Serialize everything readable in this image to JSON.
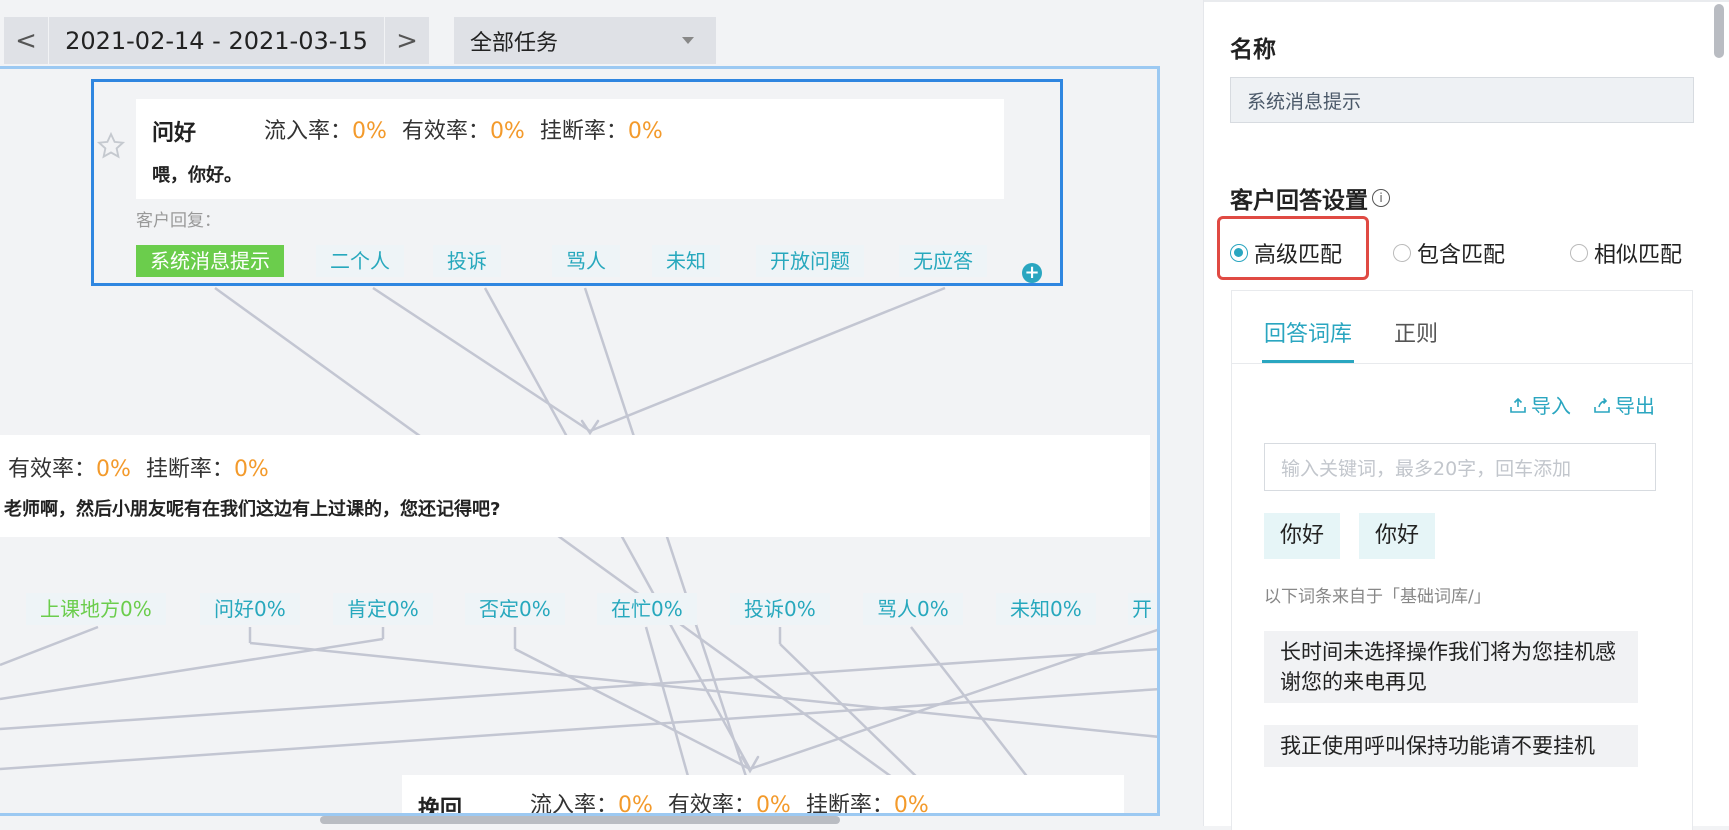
{
  "toolbar": {
    "prev_icon": "chevron-left-icon",
    "prev_glyph": "<",
    "date_range": "2021-02-14 - 2021-03-15",
    "next_icon": "chevron-right-icon",
    "next_glyph": ">",
    "task_filter": "全部任务"
  },
  "canvas": {
    "node1": {
      "title": "问好",
      "inflow_label": "流入率：",
      "inflow_value": "0%",
      "valid_label": "有效率：",
      "valid_value": "0%",
      "hangup_label": "挂断率：",
      "hangup_value": "0%",
      "message": "喂，你好。",
      "reply_label": "客户回复：",
      "replies": [
        "系统消息提示",
        "二个人",
        "投诉",
        "骂人",
        "未知",
        "开放问题",
        "无应答"
      ]
    },
    "node2": {
      "valid_label": "有效率：",
      "valid_value": "0%",
      "hangup_label": "挂断率：",
      "hangup_value": "0%",
      "message": "老师啊，然后小朋友呢有在我们这边有上过课的，您还记得吧?",
      "replies": [
        "上课地方0%",
        "问好0%",
        "肯定0%",
        "否定0%",
        "在忙0%",
        "投诉0%",
        "骂人0%",
        "未知0%",
        "开"
      ]
    },
    "node3": {
      "title": "挽回",
      "inflow_label": "流入率：",
      "inflow_value": "0%",
      "valid_label": "有效率：",
      "valid_value": "0%",
      "hangup_label": "挂断率：",
      "hangup_value": "0%"
    }
  },
  "panel": {
    "name_label": "名称",
    "name_value": "系统消息提示",
    "answer_settings_label": "客户回答设置",
    "match_modes": [
      {
        "label": "高级匹配",
        "selected": true
      },
      {
        "label": "包含匹配",
        "selected": false
      },
      {
        "label": "相似匹配",
        "selected": false
      }
    ],
    "tabs": [
      "回答词库",
      "正则"
    ],
    "import_label": "导入",
    "export_label": "导出",
    "keyword_placeholder": "输入关键词，最多20字，回车添加",
    "keywords": [
      "你好",
      "你好"
    ],
    "source_note": "以下词条来自于「基础词库/」",
    "phrases": [
      "长时间未选择操作我们将为您挂机感谢您的来电再见",
      "我正使用呼叫保持功能请不要挂机"
    ]
  },
  "colors": {
    "accent": "#2aa6c0",
    "highlight_red": "#e04a43",
    "percent_orange": "#f39a2b",
    "active_tag_green": "#6bcd4c",
    "selected_node_blue": "#2f86e0"
  }
}
